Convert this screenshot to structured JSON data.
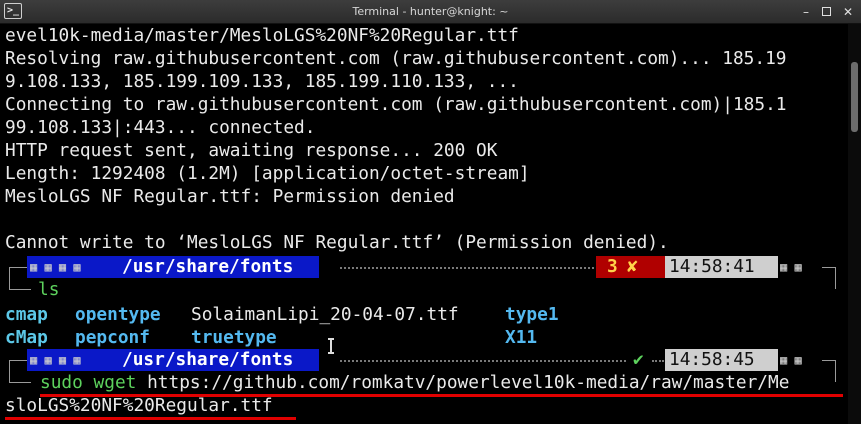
{
  "window": {
    "title": "Terminal - hunter@knight: ~",
    "icons": {
      "app": "terminal-icon",
      "minimize": "minimize-icon",
      "maximize": "maximize-icon",
      "close": "close-icon"
    }
  },
  "output": {
    "lines": [
      "evel10k-media/master/MesloLGS%20NF%20Regular.ttf",
      "Resolving raw.githubusercontent.com (raw.githubusercontent.com)... 185.19",
      "9.108.133, 185.199.109.133, 185.199.110.133, ...",
      "Connecting to raw.githubusercontent.com (raw.githubusercontent.com)|185.1",
      "99.108.133|:443... connected.",
      "HTTP request sent, awaiting response... 200 OK",
      "Length: 1292408 (1.2M) [application/octet-stream]",
      "MesloLGS NF Regular.ttf: Permission denied",
      "",
      "Cannot write to ‘MesloLGS NF Regular.ttf’ (Permission denied)."
    ]
  },
  "prompt1": {
    "path_prefix": "/usr/share/",
    "path_bold": "fonts",
    "exit_code": "3",
    "exit_symbol": "✘",
    "time": "14:58:41",
    "command": "ls"
  },
  "ls_output": {
    "row1": [
      "cmap",
      "opentype",
      "SolaimanLipi_20-04-07.ttf",
      "type1"
    ],
    "row2": [
      "cMap",
      "pepconf",
      "truetype",
      "X11"
    ]
  },
  "prompt2": {
    "path_prefix": "/usr/share/",
    "path_bold": "fonts",
    "status_symbol": "✔",
    "time": "14:58:45",
    "cmd_sudo": "sudo",
    "cmd_wget": "wget",
    "url_part1": "https://github.com/romkatv/powerlevel10k-media/raw/master/Me",
    "url_part2": "sloLGS%20NF%20Regular.ttf"
  },
  "colors": {
    "background": "#000000",
    "path_segment": "#0a18c8",
    "error_segment": "#b00000",
    "time_segment": "#cfcfcf",
    "directory": "#54b9f0",
    "command": "#5dd25d",
    "annotation_underline": "#e00000"
  }
}
